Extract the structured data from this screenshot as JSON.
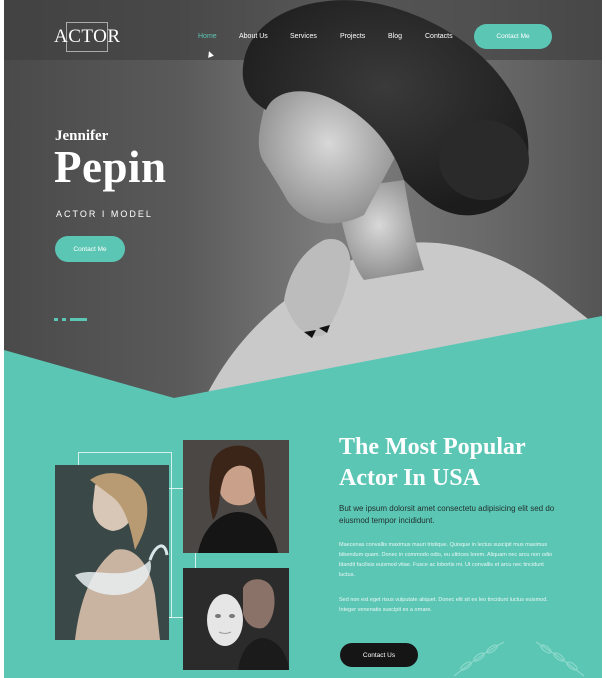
{
  "header": {
    "logo": "ACTOR",
    "nav": [
      {
        "label": "Home",
        "active": true
      },
      {
        "label": "About Us",
        "active": false
      },
      {
        "label": "Services",
        "active": false
      },
      {
        "label": "Projects",
        "active": false
      },
      {
        "label": "Blog",
        "active": false
      },
      {
        "label": "Contacts",
        "active": false
      }
    ],
    "cta_label": "Contact Me"
  },
  "hero": {
    "first_name": "Jennifer",
    "last_name": "Pepin",
    "role": "ACTOR  I  MODEL",
    "button_label": "Contact Me"
  },
  "about": {
    "title_line1": "The Most Popular",
    "title_line2": "Actor In USA",
    "lead": "But we ipsum dolorsit amet consectetu adipisicing elit sed do eiusmod tempor incididunt.",
    "paragraph1": "Maecenas convallis maximus mauri tristique. Quisque in lectus suscipit mus maximus bibendum quam. Donec in commodo odio, eu ultrices lorem. Aliquam nec arcu non odio blandit facilisis euismod vitae. Fusce ac lobortis mi. Ut convallis et arcu nec tincidunt luctus.",
    "paragraph2": "Sed non est eget risus vulputate aliquet. Donec elit sit ex leo tincidunt luctus euismod. Integer venenatis suscipit ex a ornare.",
    "button_label": "Contact Us"
  },
  "colors": {
    "accent": "#5cc6b5",
    "dark_button": "#151515"
  },
  "icons": [
    "pointer-cursor-icon",
    "laurel-leaf-icon"
  ]
}
